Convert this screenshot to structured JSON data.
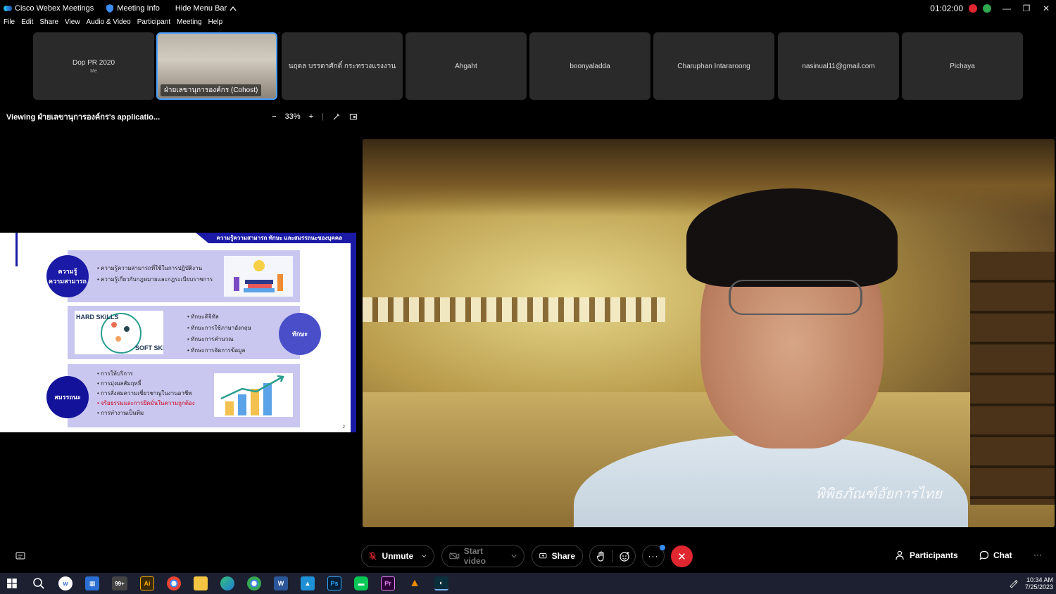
{
  "titlebar": {
    "app_name": "Cisco Webex Meetings",
    "meeting_info": "Meeting Info",
    "hide_menu": "Hide Menu Bar",
    "timer": "01:02:00",
    "minimize": "—",
    "restore": "❐",
    "close": "✕"
  },
  "menu": [
    "File",
    "Edit",
    "Share",
    "View",
    "Audio & Video",
    "Participant",
    "Meeting",
    "Help"
  ],
  "participants": [
    {
      "name": "Dop PR 2020",
      "sub": "Me"
    },
    {
      "name": "ฝ่ายเลขานุการองค์กร (Cohost)"
    },
    {
      "name": "นฤดล บรรดาศักดิ์ กระทรวงแรงงาน"
    },
    {
      "name": "Ahgaht"
    },
    {
      "name": "boonyaladda"
    },
    {
      "name": "Charuphan Intararoong"
    },
    {
      "name": "nasinual11@gmail.com"
    },
    {
      "name": "Pichaya"
    }
  ],
  "viewing": {
    "label": "Viewing ฝ่ายเลขานุการองค์กร's applicatio...",
    "zoom": "33%",
    "minus": "−",
    "plus": "+"
  },
  "slide": {
    "header": "ความรู้ความสามารถ ทักษะ และสมรรถนะของบุคคล",
    "circle1": "ความรู้\nความสามารถ",
    "circle1_line1": "ความรู้",
    "circle1_line2": "ความสามารถ",
    "bullets1": [
      "ความรู้ความสามารถที่ใช้ในการปฏิบัติงาน",
      "ความรู้เกี่ยวกับกฎหมายและกฎระเบียบราชการ"
    ],
    "circle2": "ทักษะ",
    "bullets2": [
      "ทักษะดิจิทัล",
      "ทักษะการใช้ภาษาอังกฤษ",
      "ทักษะการคำนวณ",
      "ทักษะการจัดการข้อมูล"
    ],
    "hard_skills": "HARD SKILLS",
    "soft_skills": "SOFT SKILLS",
    "circle3": "สมรรถนะ",
    "bullets3": [
      "การให้บริการ",
      "การมุ่งผลสัมฤทธิ์",
      "การสั่งสมความเชี่ยวชาญในงานอาชีพ",
      "จริยธรรมและการยึดมั่นในความถูกต้อง",
      "การทำงานเป็นทีม"
    ],
    "page_number": "2",
    "accent": "#1a1aa6",
    "circle_color": "#1a1aa6",
    "band_color": "#c9c7ef"
  },
  "video": {
    "watermark": "พิพิธภัณฑ์อัยการไทย"
  },
  "controls": {
    "unmute": "Unmute",
    "start_video": "Start video",
    "share": "Share",
    "participants": "Participants",
    "chat": "Chat",
    "end_color": "#e0262f"
  },
  "taskbar": {
    "badge": "99+",
    "time": "10:34 AM",
    "date": "7/25/2023"
  }
}
